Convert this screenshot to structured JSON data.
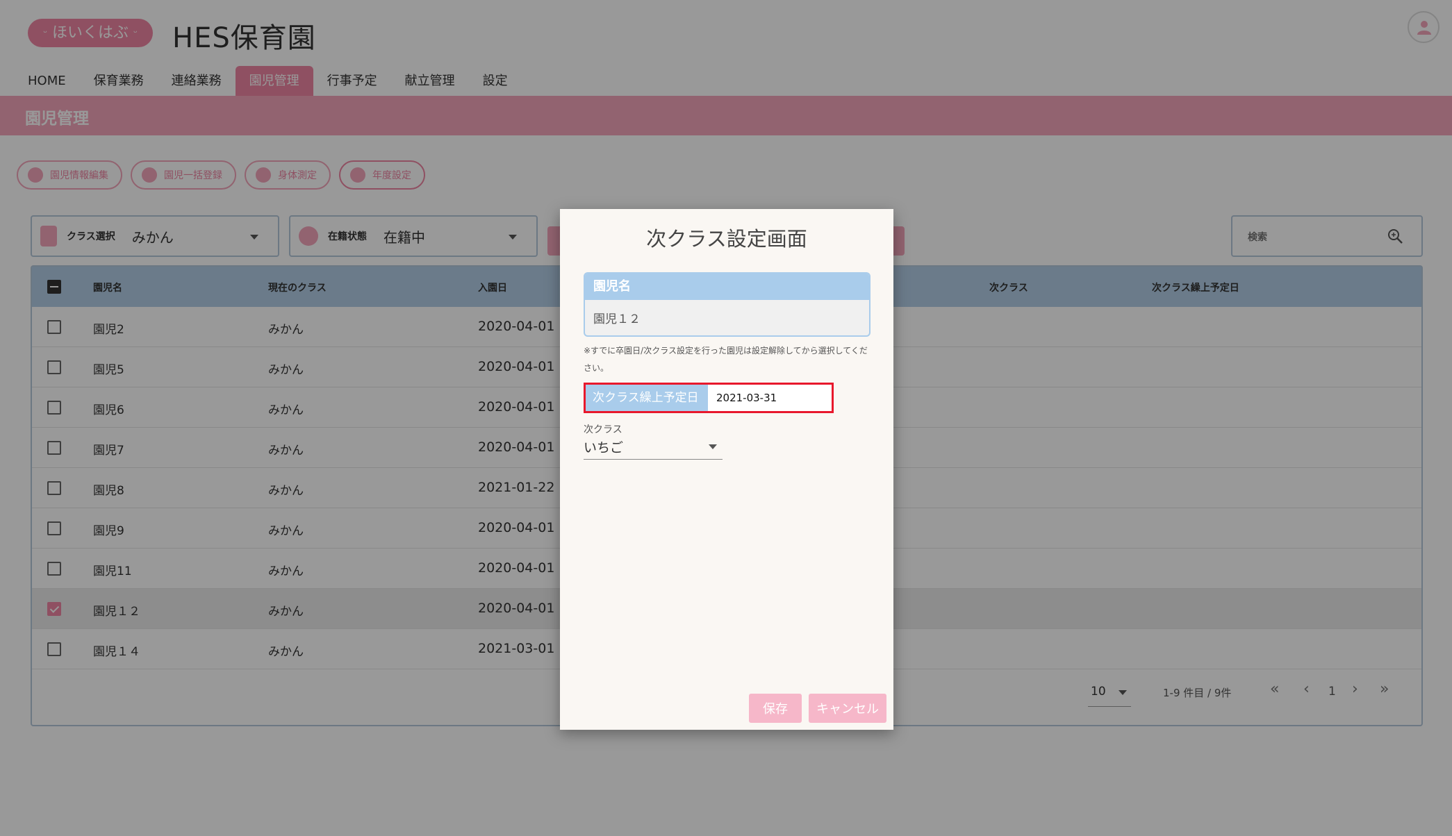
{
  "header": {
    "logo_text": "ほいくはぶ",
    "title": "HES保育園"
  },
  "nav": [
    {
      "label": "HOME"
    },
    {
      "label": "保育業務"
    },
    {
      "label": "連絡業務"
    },
    {
      "label": "園児管理"
    },
    {
      "label": "行事予定"
    },
    {
      "label": "献立管理"
    },
    {
      "label": "設定"
    }
  ],
  "page": {
    "title": "園児管理"
  },
  "actions": [
    {
      "label": "園児情報編集"
    },
    {
      "label": "園児一括登録"
    },
    {
      "label": "身体測定"
    },
    {
      "label": "年度設定"
    }
  ],
  "filters": {
    "class": {
      "label": "クラス選択",
      "value": "みかん"
    },
    "status": {
      "label": "在籍状態",
      "value": "在籍中"
    }
  },
  "search": {
    "placeholder": "検索"
  },
  "table": {
    "columns": [
      "園児名",
      "現在のクラス",
      "入園日",
      "次クラス",
      "次クラス繰上予定日"
    ],
    "rows": [
      {
        "name": "園児2",
        "class": "みかん",
        "date": "2020-04-01",
        "checked": false
      },
      {
        "name": "園児5",
        "class": "みかん",
        "date": "2020-04-01",
        "checked": false
      },
      {
        "name": "園児6",
        "class": "みかん",
        "date": "2020-04-01",
        "checked": false
      },
      {
        "name": "園児7",
        "class": "みかん",
        "date": "2020-04-01",
        "checked": false
      },
      {
        "name": "園児8",
        "class": "みかん",
        "date": "2021-01-22",
        "checked": false
      },
      {
        "name": "園児9",
        "class": "みかん",
        "date": "2020-04-01",
        "checked": false
      },
      {
        "name": "園児11",
        "class": "みかん",
        "date": "2020-04-01",
        "checked": false
      },
      {
        "name": "園児１２",
        "class": "みかん",
        "date": "2020-04-01",
        "checked": true
      },
      {
        "name": "園児１４",
        "class": "みかん",
        "date": "2021-03-01",
        "checked": false
      }
    ]
  },
  "pagination": {
    "rows_per_page": "10",
    "range": "1-9 件目 / 9件",
    "page": "1"
  },
  "modal": {
    "title": "次クラス設定画面",
    "name_label": "園児名",
    "name_value": "園児１２",
    "note": "※すでに卒園日/次クラス設定を行った園児は設定解除してから選択してください。",
    "date_label": "次クラス繰上予定日",
    "date_value": "2021-03-31",
    "class_label": "次クラス",
    "class_value": "いちご",
    "save_label": "保存",
    "cancel_label": "キャンセル"
  }
}
